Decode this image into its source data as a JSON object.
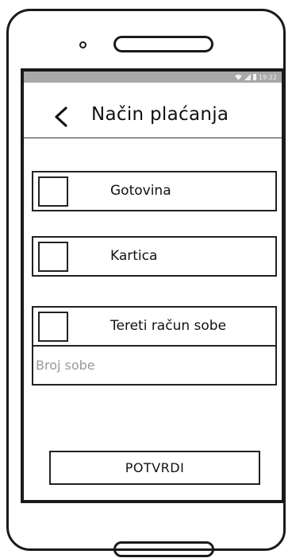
{
  "status_bar": {
    "time": "19:22",
    "icons": [
      "wifi-icon",
      "signal-icon",
      "battery-icon"
    ]
  },
  "header": {
    "back_icon": "chevron-left-icon",
    "title": "Način plaćanja"
  },
  "payment_options": [
    {
      "label": "Gotovina",
      "checked": false
    },
    {
      "label": "Kartica",
      "checked": false
    },
    {
      "label": "Tereti račun sobe",
      "checked": false
    }
  ],
  "room_number": {
    "value": "",
    "placeholder": "Broj sobe"
  },
  "confirm_label": "POTVRDI",
  "colors": {
    "status_bar": "#a8a8a8",
    "outline": "#1a1a1a",
    "placeholder": "#9a9a9a"
  }
}
